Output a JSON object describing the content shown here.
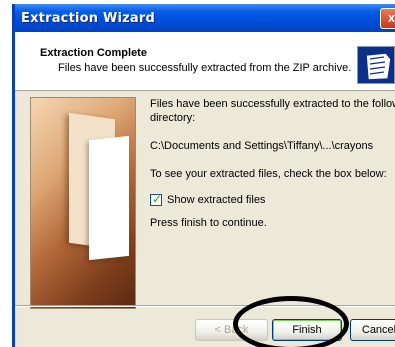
{
  "window": {
    "title": "Extraction Wizard",
    "close_symbol": "x"
  },
  "header": {
    "title": "Extraction Complete",
    "subtitle": "Files have been successfully extracted from the ZIP archive."
  },
  "body": {
    "line1": "Files have been successfully extracted to the following",
    "line2": "directory:",
    "path": "C:\\Documents and Settings\\Tiffany\\...\\crayons",
    "instruction": "To see your extracted files, check the box below:",
    "checkbox_label": "Show extracted files",
    "checkbox_checked": true,
    "finish_hint": "Press finish to continue."
  },
  "buttons": {
    "back": "< Back",
    "finish": "Finish",
    "cancel": "Cancel"
  },
  "colors": {
    "titlebar": "#0050df",
    "dialog_bg": "#ece9d8",
    "header_icon": "#0c2f8a"
  }
}
